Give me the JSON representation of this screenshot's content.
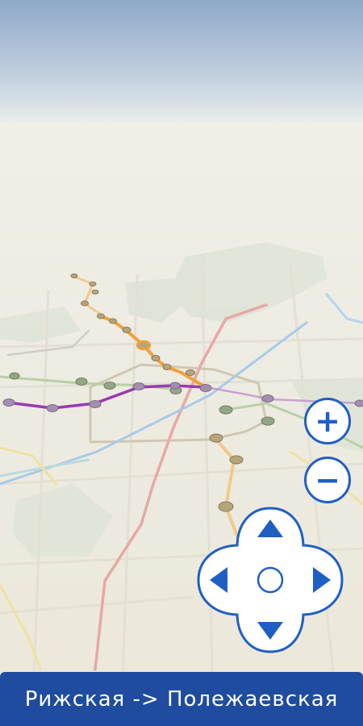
{
  "colors": {
    "sky_top": "#8fa9c9",
    "sky_horizon": "#f3f3ee",
    "ground": "#efece2",
    "park": "#d9e0d2",
    "route_line": "#f2a03a",
    "purple_line": "#9b38b5",
    "accent": "#1f5fc4",
    "bottom_bar": "#1f4c9e"
  },
  "controls": {
    "zoom_in_icon": "plus-icon",
    "zoom_out_icon": "minus-icon",
    "dpad_up_icon": "arrow-up-icon",
    "dpad_down_icon": "arrow-down-icon",
    "dpad_left_icon": "arrow-left-icon",
    "dpad_right_icon": "arrow-right-icon"
  },
  "zoom_in_label": "+",
  "zoom_out_label": "−",
  "route_label": "Рижская -> Полежаевская"
}
